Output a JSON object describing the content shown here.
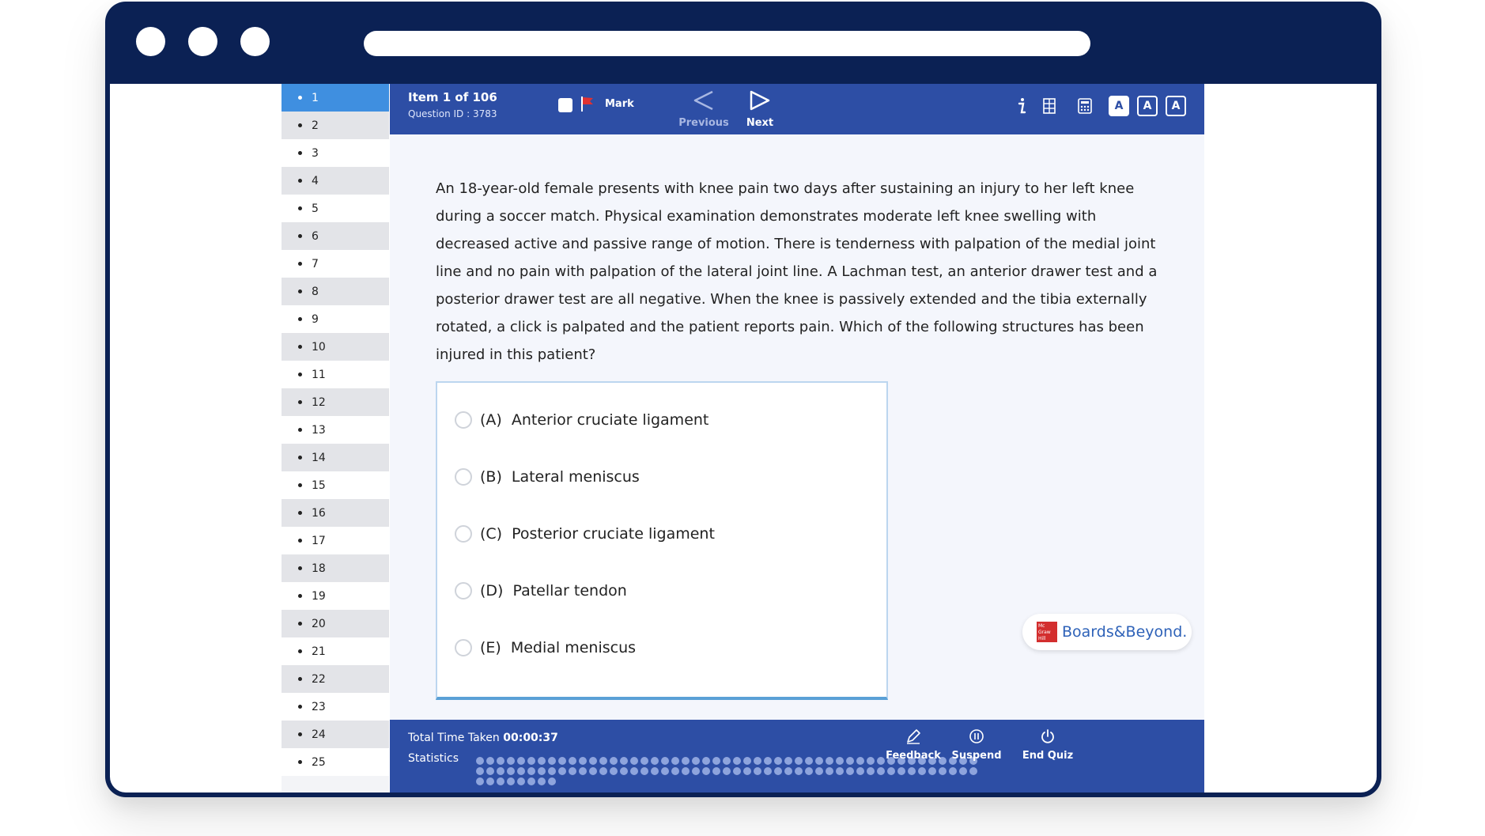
{
  "exam": {
    "item_label": "Item 1 of 106",
    "question_id": "Question ID : 3783",
    "mark_label": "Mark",
    "previous_label": "Previous",
    "next_label": "Next",
    "font_sizes": [
      "A",
      "A",
      "A"
    ]
  },
  "nav": {
    "items": [
      "1",
      "2",
      "3",
      "4",
      "5",
      "6",
      "7",
      "8",
      "9",
      "10",
      "11",
      "12",
      "13",
      "14",
      "15",
      "16",
      "17",
      "18",
      "19",
      "20",
      "21",
      "22",
      "23",
      "24",
      "25"
    ],
    "active_index": 0
  },
  "question": {
    "text": "An 18-year-old female presents with knee pain two days after sustaining an injury to her left knee during a soccer match. Physical examination demonstrates moderate left knee swelling with decreased active and passive range of motion. There is tenderness with palpation of the medial joint line and no pain with palpation of the lateral joint line. A Lachman test, an anterior drawer test and a posterior drawer test are all negative. When the knee is passively extended and the tibia externally rotated, a click is palpated and the patient reports pain. Which of the following structures has been injured in this patient?"
  },
  "answers": [
    {
      "letter": "(A)",
      "text": "Anterior cruciate ligament"
    },
    {
      "letter": "(B)",
      "text": "Lateral meniscus"
    },
    {
      "letter": "(C)",
      "text": "Posterior cruciate ligament"
    },
    {
      "letter": "(D)",
      "text": "Patellar tendon"
    },
    {
      "letter": "(E)",
      "text": "Medial meniscus"
    }
  ],
  "logo": {
    "mark_text": "Mc Graw Hill",
    "brand": "Boards&Beyond."
  },
  "footer": {
    "time_label": "Total Time Taken",
    "time_value": "00:00:37",
    "statistics_label": "Statistics",
    "feedback_label": "Feedback",
    "suspend_label": "Suspend",
    "end_label": "End Quiz"
  },
  "icons": {
    "info": "info-icon",
    "lab_values": "lab-values-icon",
    "calculator": "calculator-icon",
    "flag": "flag-icon",
    "feedback": "edit-icon",
    "suspend": "pause-icon",
    "end": "power-icon"
  },
  "colors": {
    "frame": "#0b2154",
    "bar": "#2d4ea5",
    "active_nav": "#3f8fe0",
    "flag": "#e03131"
  }
}
